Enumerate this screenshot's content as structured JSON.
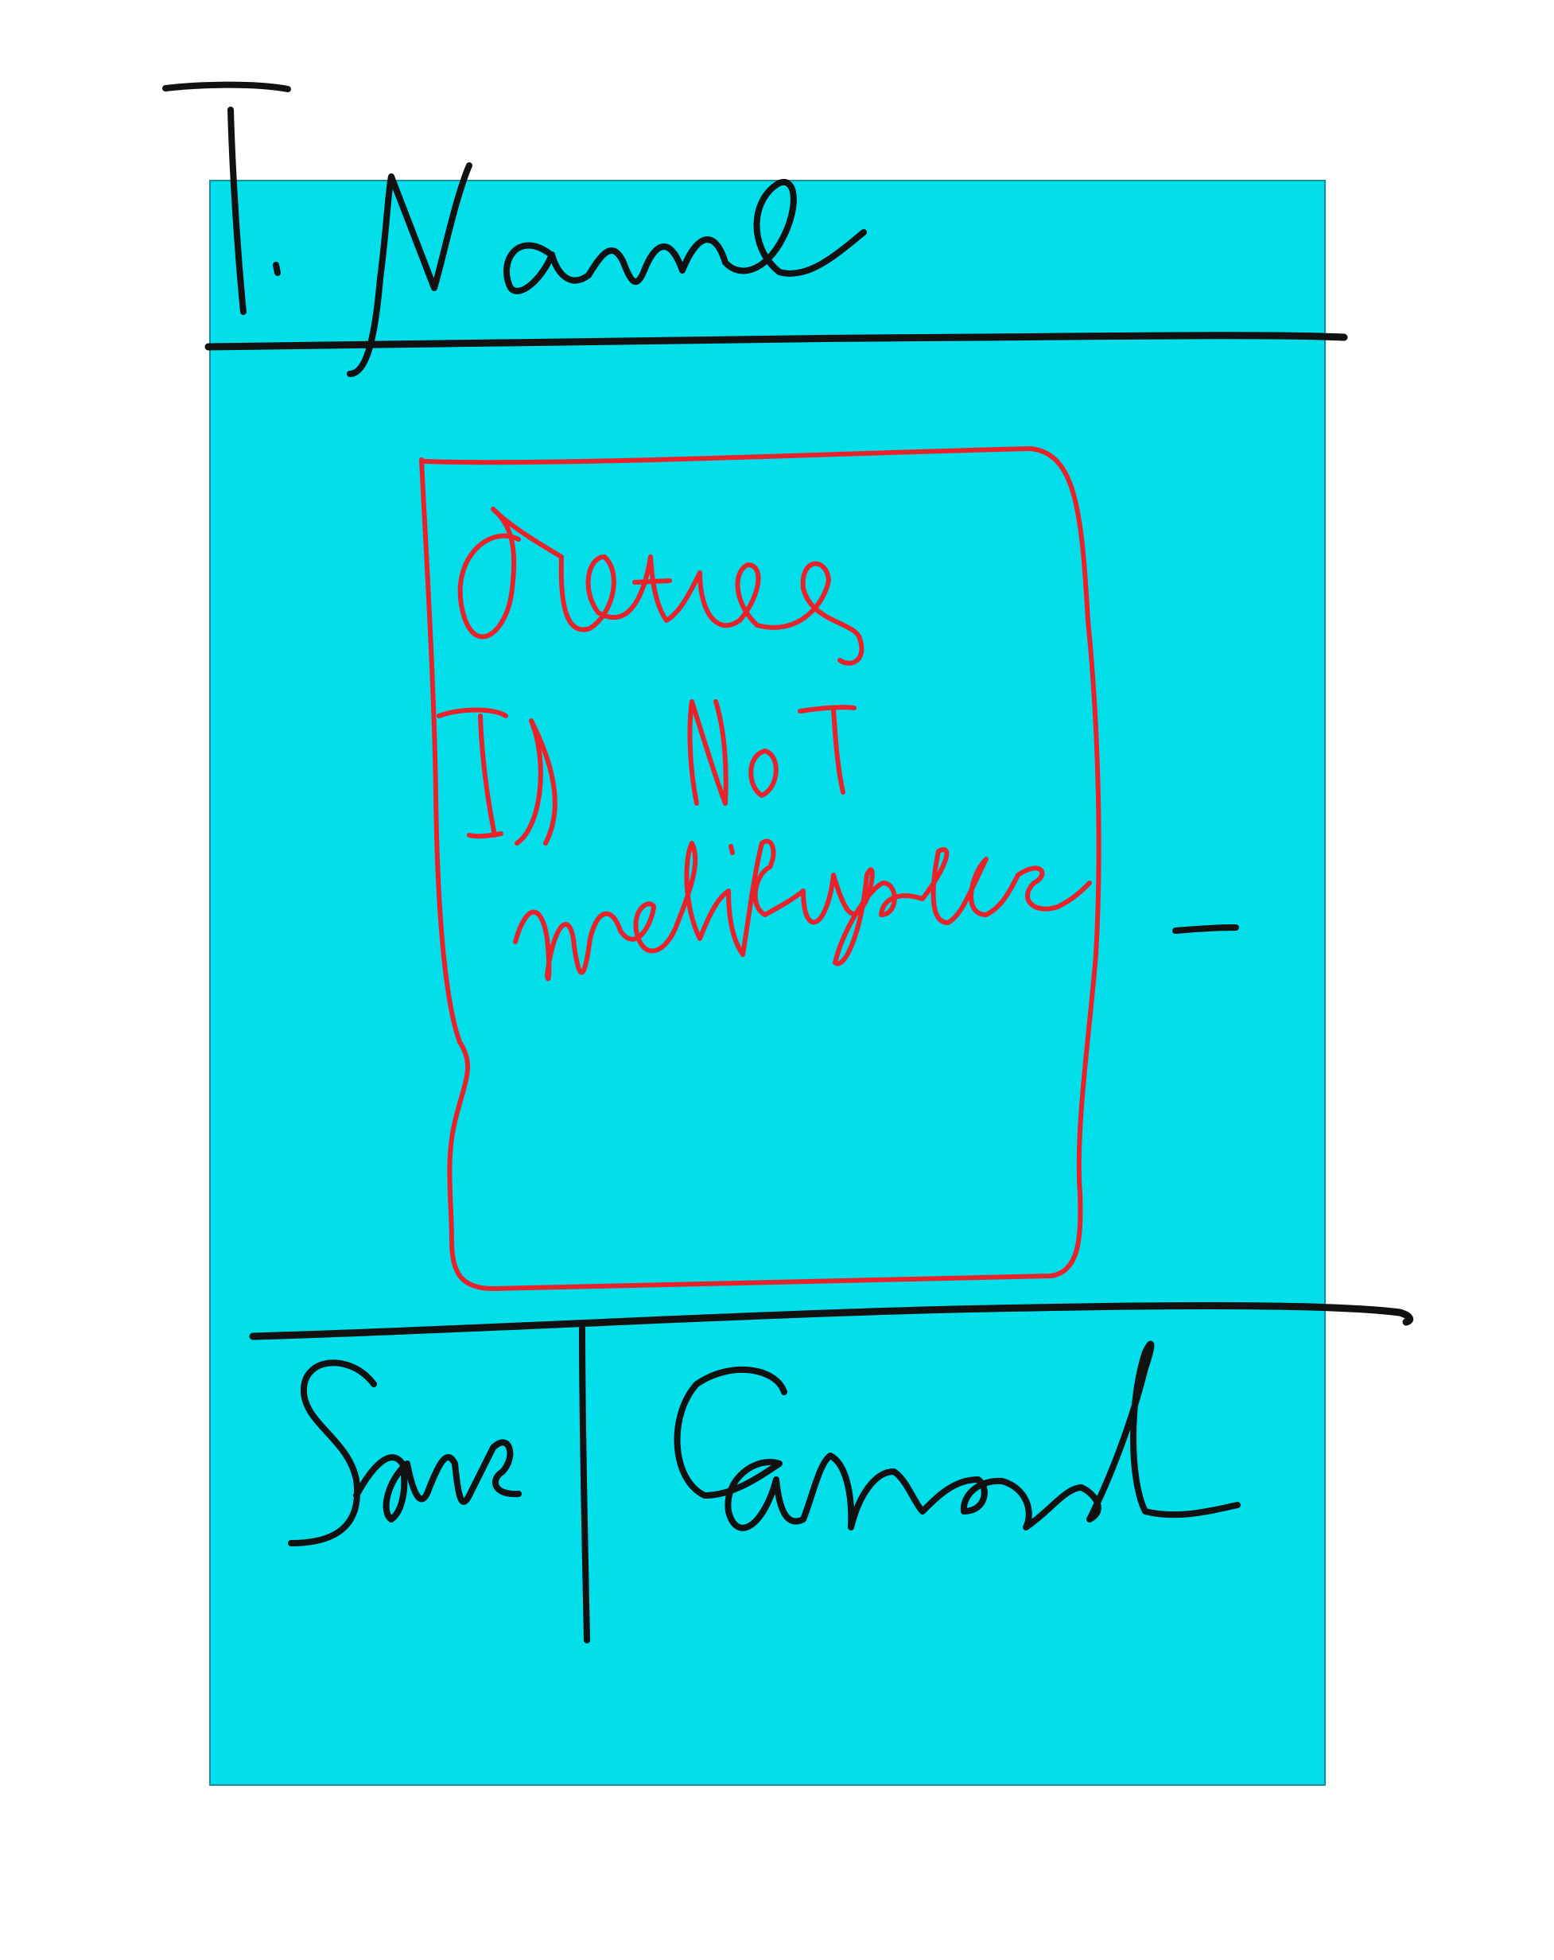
{
  "mockup": {
    "background_color": "#ffffff",
    "panel_color": "#03dfea",
    "ink_color": "#111111",
    "annotation_color": "#e8222a",
    "header": {
      "title": "T. Name"
    },
    "content_area": {
      "line_1": "Datas",
      "line_2": "ID NOT",
      "line_3": "modifyable"
    },
    "footer": {
      "save_label": "Save",
      "cancel_label": "Cancel"
    }
  }
}
